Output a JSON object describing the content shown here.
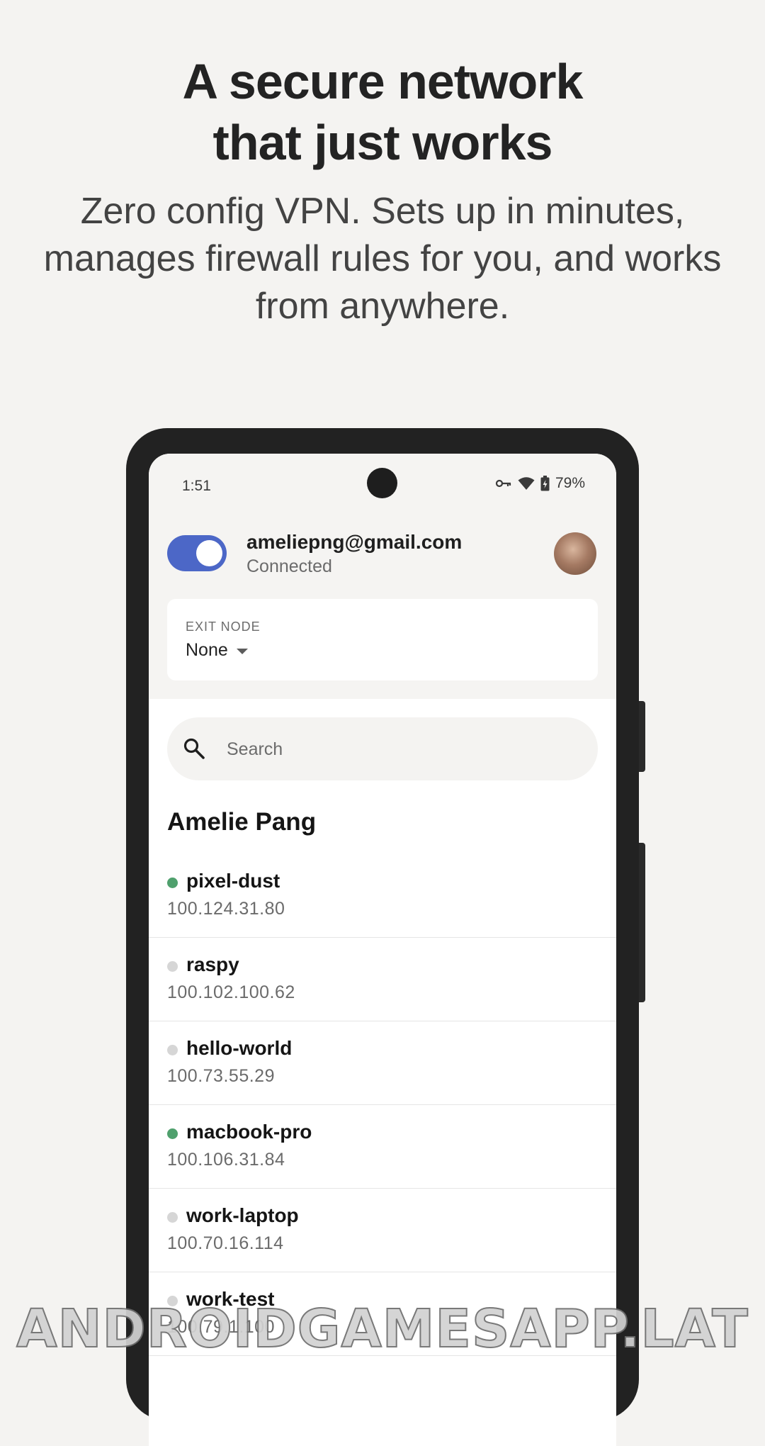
{
  "hero": {
    "headline_line1": "A secure network",
    "headline_line2": "that just works",
    "subline": "Zero config VPN. Sets up in minutes, manages firewall rules for you, and works from anywhere."
  },
  "status_bar": {
    "time": "1:51",
    "battery": "79%",
    "icons": [
      "vpn-key-icon",
      "wifi-icon",
      "battery-charging-icon"
    ]
  },
  "account": {
    "toggle_on": true,
    "email": "ameliepng@gmail.com",
    "status": "Connected",
    "accent_color": "#4c67c7"
  },
  "exit_node": {
    "label": "EXIT NODE",
    "value": "None"
  },
  "search": {
    "placeholder": "Search"
  },
  "owner": "Amelie Pang",
  "devices": [
    {
      "name": "pixel-dust",
      "ip": "100.124.31.80",
      "online": true
    },
    {
      "name": "raspy",
      "ip": "100.102.100.62",
      "online": false
    },
    {
      "name": "hello-world",
      "ip": "100.73.55.29",
      "online": false
    },
    {
      "name": "macbook-pro",
      "ip": "100.106.31.84",
      "online": true
    },
    {
      "name": "work-laptop",
      "ip": "100.70.16.114",
      "online": false
    },
    {
      "name": "work-test",
      "ip": "100.79.1.100",
      "online": false
    }
  ],
  "colors": {
    "online": "#4fa06d",
    "offline": "#d6d6d6"
  },
  "watermark": "ANDROIDGAMESAPP.LAT"
}
